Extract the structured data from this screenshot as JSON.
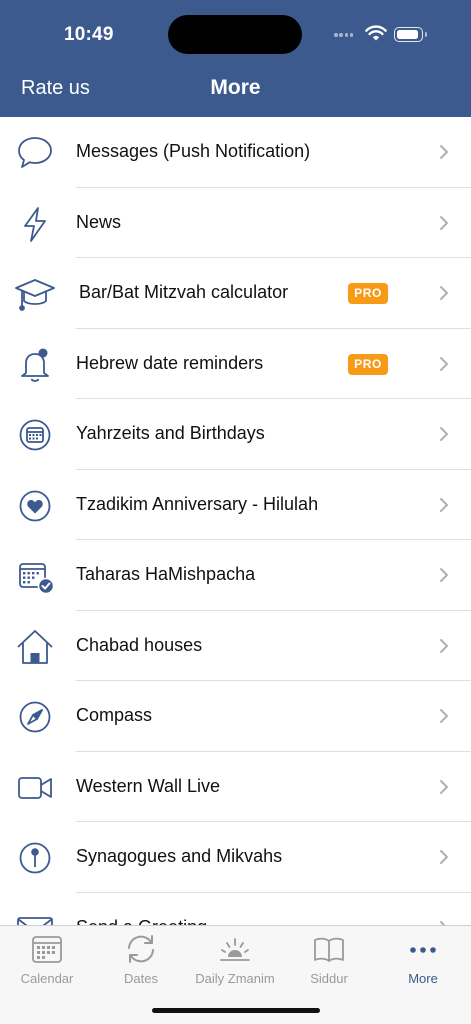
{
  "status_bar": {
    "time": "10:49"
  },
  "nav": {
    "left_label": "Rate us",
    "title": "More"
  },
  "colors": {
    "brand": "#3c5a8e",
    "pro_badge": "#f79a16",
    "inactive_tab": "#9a9a9a"
  },
  "menu": {
    "items": [
      {
        "label": "Messages (Push Notification)",
        "icon": "speech-bubble-icon",
        "pro": false
      },
      {
        "label": "News",
        "icon": "lightning-icon",
        "pro": false
      },
      {
        "label": "Bar/Bat Mitzvah calculator",
        "icon": "graduation-cap-icon",
        "pro": true,
        "badge": "PRO"
      },
      {
        "label": "Hebrew date reminders",
        "icon": "bell-icon",
        "pro": true,
        "badge": "PRO"
      },
      {
        "label": "Yahrzeits and Birthdays",
        "icon": "calendar-circle-icon",
        "pro": false
      },
      {
        "label": "Tzadikim Anniversary - Hilulah",
        "icon": "heart-circle-icon",
        "pro": false
      },
      {
        "label": "Taharas HaMishpacha",
        "icon": "calendar-check-icon",
        "pro": false
      },
      {
        "label": "Chabad houses",
        "icon": "house-icon",
        "pro": false
      },
      {
        "label": "Compass",
        "icon": "compass-icon",
        "pro": false
      },
      {
        "label": "Western Wall Live",
        "icon": "video-camera-icon",
        "pro": false
      },
      {
        "label": "Synagogues and Mikvahs",
        "icon": "map-pin-icon",
        "pro": false
      },
      {
        "label": "Send a Greeting",
        "icon": "envelope-icon",
        "pro": false
      }
    ]
  },
  "tabbar": {
    "tabs": [
      {
        "label": "Calendar",
        "icon": "calendar-icon",
        "active": false
      },
      {
        "label": "Dates",
        "icon": "sync-icon",
        "active": false
      },
      {
        "label": "Daily Zmanim",
        "icon": "sunrise-icon",
        "active": false
      },
      {
        "label": "Siddur",
        "icon": "book-icon",
        "active": false
      },
      {
        "label": "More",
        "icon": "more-dots-icon",
        "active": true
      }
    ]
  }
}
